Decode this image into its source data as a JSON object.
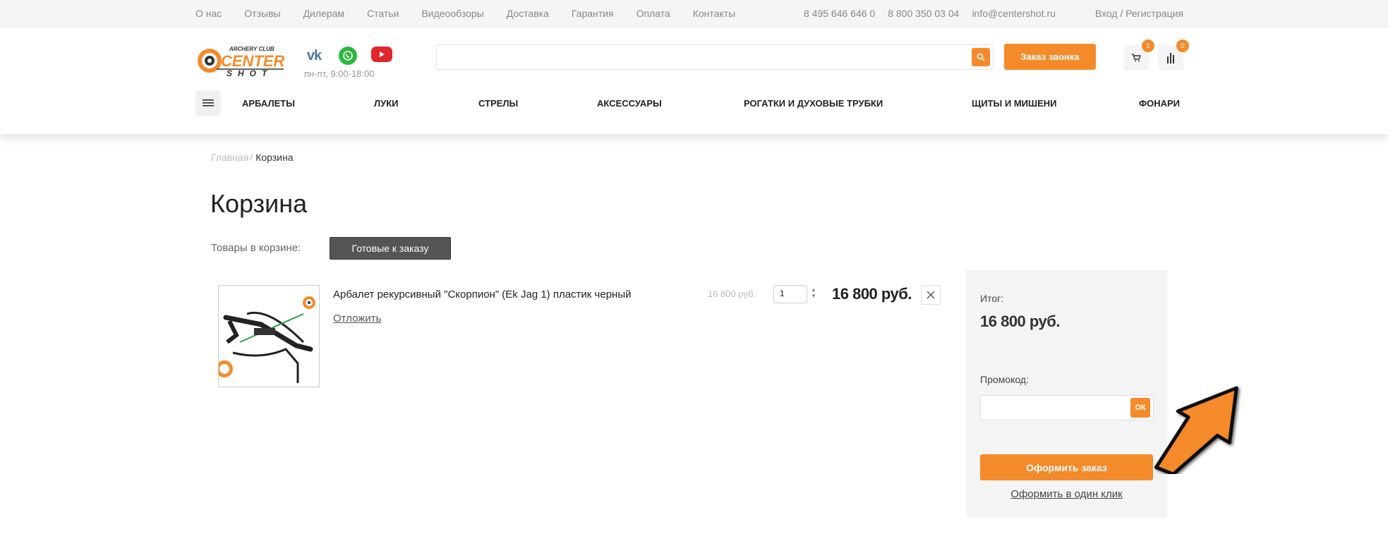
{
  "topbar": {
    "links": [
      "О нас",
      "Отзывы",
      "Дилерам",
      "Статьи",
      "Видеообзоры",
      "Доставка",
      "Гарантия",
      "Оплата",
      "Контакты"
    ],
    "phone1": "8 495 646 646 0",
    "phone2": "8 800 350 03 04",
    "email": "info@centershot.ru",
    "login": "Вход / Регистрация"
  },
  "header": {
    "logo_text_top": "ARCHERY CLUB",
    "logo_text_main": "CENTER",
    "logo_text_bottom": "SHOT",
    "hours": "пн-пт, 9:00-18:00",
    "social": [
      "vk-icon",
      "whatsapp-icon",
      "youtube-icon"
    ],
    "search_placeholder": "",
    "call_button": "Заказ звонка",
    "cart_count": "1",
    "compare_count": "0"
  },
  "menu": {
    "items": [
      "АРБАЛЕТЫ",
      "ЛУКИ",
      "СТРЕЛЫ",
      "АКСЕССУАРЫ",
      "РОГАТКИ И ДУХОВЫЕ ТРУБКИ",
      "ЩИТЫ И МИШЕНИ",
      "ФОНАРИ"
    ]
  },
  "breadcrumb": {
    "home": "Главная",
    "sep": "/",
    "current": "Корзина"
  },
  "page": {
    "title": "Корзина",
    "cart_label": "Товары в корзине:",
    "ready_tab": "Готовые к заказу"
  },
  "item": {
    "name": "Арбалет рекурсивный \"Скорпион\" (Ek Jag 1) пластик черный",
    "postpone": "Отложить",
    "unit_price": "16 800 руб.",
    "quantity": "1",
    "total": "16 800 руб."
  },
  "summary": {
    "total_label": "Итог:",
    "total_value": "16 800 руб.",
    "promo_label": "Промокод:",
    "promo_value": "",
    "promo_ok": "ОК",
    "checkout": "Оформить заказ",
    "one_click": "Оформить в один клик"
  },
  "colors": {
    "accent": "#f58a2a",
    "dark_tab": "#555555",
    "panel_bg": "#f4f4f4"
  }
}
